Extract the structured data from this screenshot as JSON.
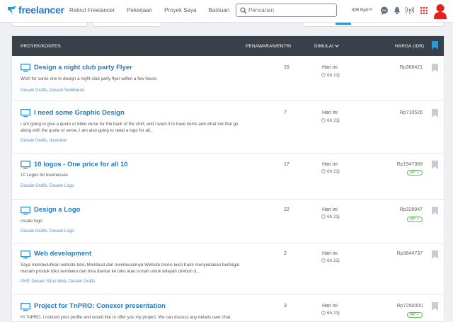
{
  "brand": {
    "name": "freelancer",
    "color": "#2a74c4"
  },
  "nav": [
    "Rekrut Freelancer",
    "Pekerjaan",
    "Proyek Saya",
    "Bantuan"
  ],
  "search": {
    "placeholder": "Pencarian",
    "value": ""
  },
  "balance": "IDR Rp0¹³⁰",
  "header_icons": [
    "chat-icon",
    "bell-icon",
    "broadcast-icon",
    "apps-grid-icon",
    "avatar"
  ],
  "table": {
    "columns": {
      "project": "PROYEK/KONTES",
      "bids": "PENAWARAN/ENTRI",
      "started": "DIMULAI",
      "price": "HARGA (IDR)"
    },
    "rows": [
      {
        "title": "Design a night club party Flyer",
        "description": "Wish for some one to design a night club party flyer within a few hours.",
        "tags": "Desain Grafis, Desain Selebaran",
        "bids": "15",
        "started": "Hari ini",
        "time_left": "6h 23j",
        "price": "Rp368421",
        "badge": ""
      },
      {
        "title": "I need some Graphic Design",
        "description": "I am going to give a quote or bible verse for the back of the shirt, and i want it to have items and what not that go along with the quote or verse. I am also going to need a logo for all...",
        "tags": "Desain Grafis, Ilustrator",
        "bids": "7",
        "started": "Hari ini",
        "time_left": "6h 23j",
        "price": "Rp710526",
        "badge": ""
      },
      {
        "title": "10 logos - One price for all 10",
        "description": "10 Logos for businesses",
        "tags": "Desain Grafis, Desain Logo",
        "bids": "17",
        "started": "Hari ini",
        "time_left": "6h 23j",
        "price": "Rp1947368",
        "badge": "RP ✓"
      },
      {
        "title": "Design a Logo",
        "description": "create logo",
        "tags": "Desain Grafis, Desain Logo",
        "bids": "22",
        "started": "Hari ini",
        "time_left": "6h 23j",
        "price": "Rp328947",
        "badge": "RP ✓"
      },
      {
        "title": "Web development",
        "description": "Saya membutuhkan website baru Membuat dan mendesainnya Website bisnis kecil Kami menyediakan berbagai macam produk toko sembako dan bisa diantar ke toko atau rumah untuk wilayah cirebon d...",
        "tags": "PHP, Desain Situs Web, Desain Grafis",
        "bids": "2",
        "started": "Hari ini",
        "time_left": "6h 23j",
        "price": "Rp3644737",
        "badge": ""
      },
      {
        "title": "Project for TnPRO: Conexer presentation",
        "description": "Hi TnPRO, I noticed your profile and would like to offer you my project. We can discuss any details over chat.",
        "tags": "",
        "bids": "3",
        "started": "Hari ini",
        "time_left": "6h 23j",
        "price": "Rp7250000",
        "badge": "RP ✓"
      }
    ]
  },
  "colors": {
    "header_bg": "#3a4049",
    "link": "#1f7ac2",
    "tag": "#4f8cc9",
    "badge": "#5cb85c",
    "avatar": "#e8201c"
  }
}
